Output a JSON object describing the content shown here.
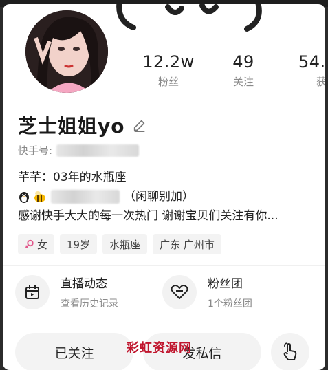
{
  "profile": {
    "name": "芝士姐姐yo",
    "id_label": "快手号:"
  },
  "stats": [
    {
      "value": "12.2w",
      "label": "粉丝"
    },
    {
      "value": "49",
      "label": "关注"
    },
    {
      "value": "54.",
      "label": "获"
    }
  ],
  "bio": {
    "line1": "芊芊：03年的水瓶座",
    "line2_suffix": "（闲聊别加）",
    "line3": "感谢快手大大的每一次热门 谢谢宝贝们关注有你..."
  },
  "tags": [
    {
      "label": "女",
      "icon": "female-icon"
    },
    {
      "label": "19岁"
    },
    {
      "label": "水瓶座"
    },
    {
      "label": "广东 广州市"
    }
  ],
  "features": [
    {
      "title": "直播动态",
      "subtitle": "查看历史记录",
      "icon": "calendar-icon"
    },
    {
      "title": "粉丝团",
      "subtitle": "1个粉丝团",
      "icon": "heart-icon"
    }
  ],
  "actions": {
    "followed_label": "已关注",
    "message_label": "发私信"
  },
  "watermark": "彩虹资源网",
  "colors": {
    "background": "#ffffff",
    "tag_bg": "#f3f3f3",
    "watermark": "#c0162e",
    "female_icon": "#e2568a"
  }
}
